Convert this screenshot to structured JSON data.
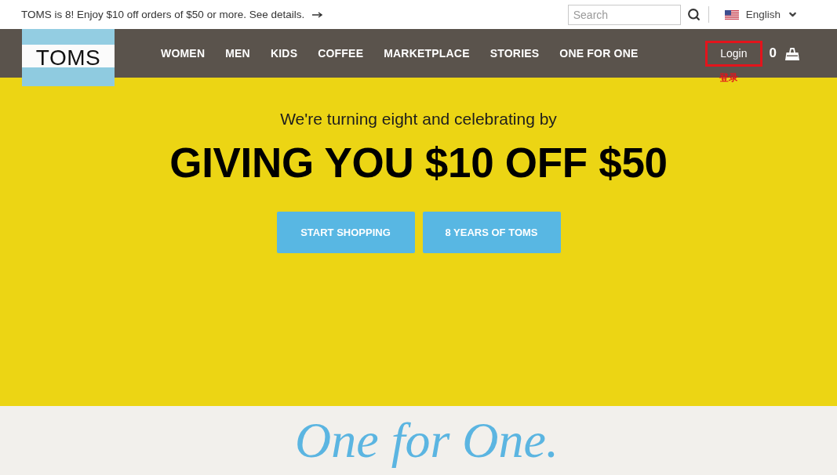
{
  "promo_bar": {
    "message": "TOMS is 8! Enjoy $10 off orders of $50 or more. See details."
  },
  "search": {
    "placeholder": "Search"
  },
  "language": {
    "label": "English"
  },
  "logo": {
    "text": "TOMS"
  },
  "nav": {
    "items": [
      {
        "label": "WOMEN"
      },
      {
        "label": "MEN"
      },
      {
        "label": "KIDS"
      },
      {
        "label": "COFFEE"
      },
      {
        "label": "MARKETPLACE"
      },
      {
        "label": "STORIES"
      },
      {
        "label": "ONE FOR ONE"
      }
    ]
  },
  "account": {
    "login": "Login",
    "highlighted": true,
    "annotation": "登录",
    "cart_count": "0"
  },
  "hero": {
    "intro": "We're turning eight and celebrating by",
    "headline": "GIVING YOU $10 OFF $50",
    "buttons": [
      {
        "label": "START SHOPPING"
      },
      {
        "label": "8 YEARS OF TOMS"
      }
    ]
  },
  "one_for_one": {
    "tagline": "One for One."
  }
}
